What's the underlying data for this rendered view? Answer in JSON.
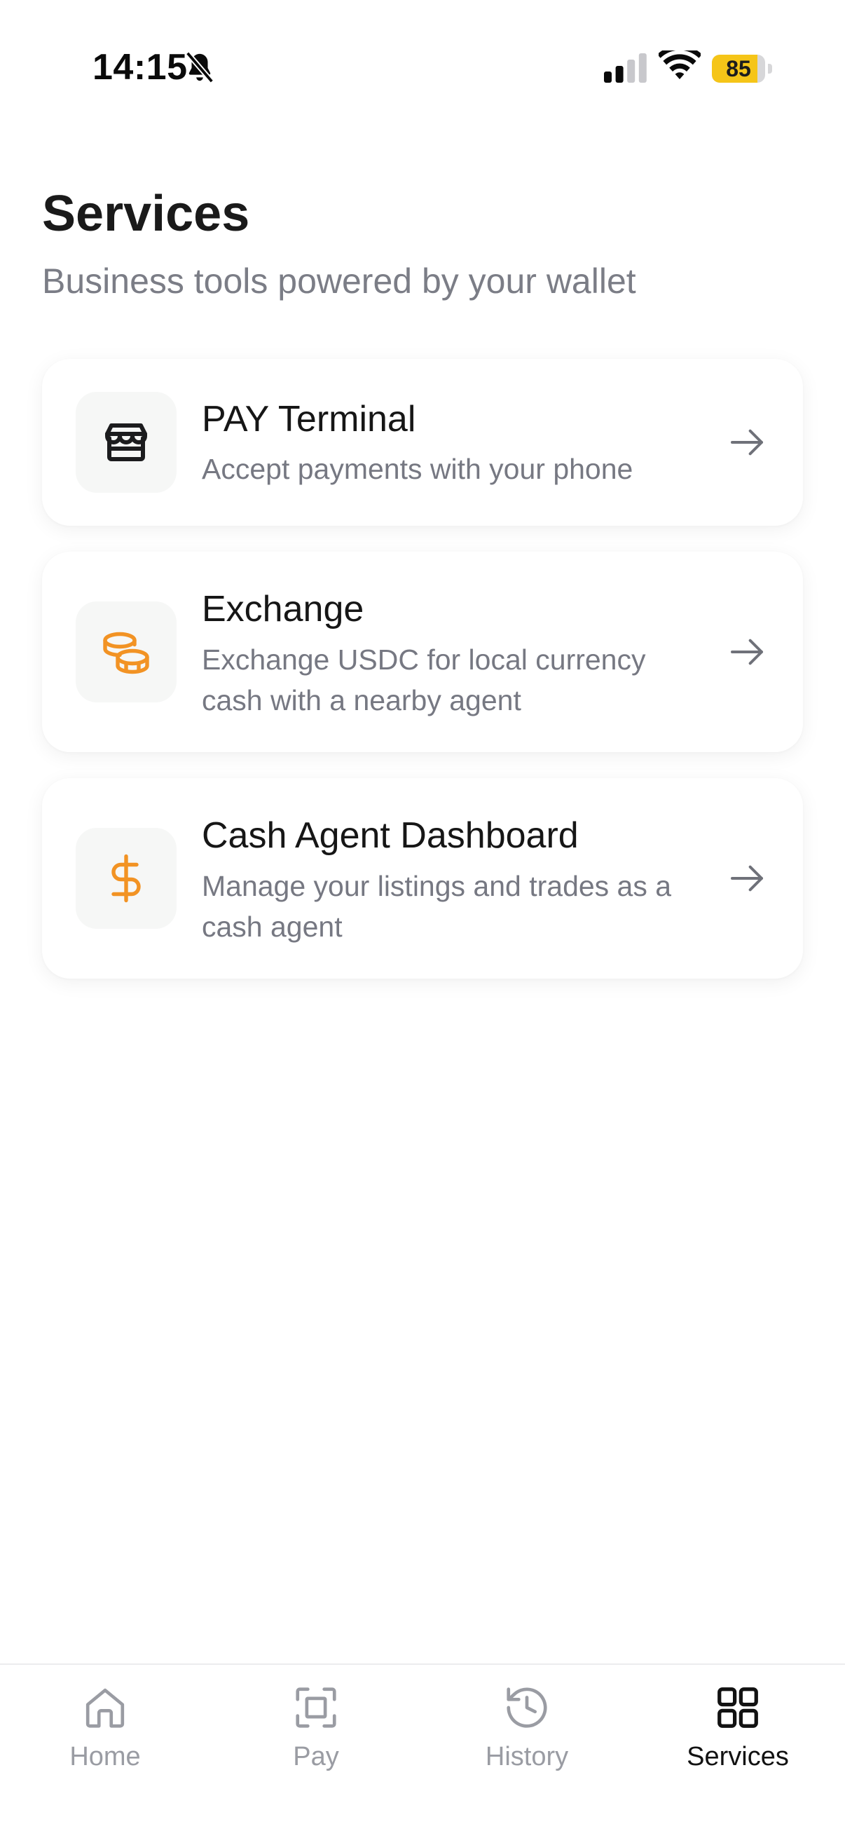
{
  "status_bar": {
    "time": "14:15",
    "battery_level": "85",
    "battery_fraction": 0.85,
    "battery_color": "#f5c518"
  },
  "header": {
    "title": "Services",
    "subtitle": "Business tools powered by your wallet"
  },
  "services": [
    {
      "title": "PAY Terminal",
      "description": "Accept payments with your phone",
      "icon": "storefront-icon",
      "icon_color": "#1c1c1e"
    },
    {
      "title": "Exchange",
      "description": "Exchange USDC for local currency cash with a nearby agent",
      "icon": "coins-icon",
      "icon_color": "#f29324"
    },
    {
      "title": "Cash Agent Dashboard",
      "description": "Manage your listings and trades as a cash agent",
      "icon": "dollar-sign-icon",
      "icon_color": "#f29324"
    }
  ],
  "bottom_nav": {
    "items": [
      {
        "label": "Home",
        "icon": "home-icon",
        "active": false
      },
      {
        "label": "Pay",
        "icon": "scan-icon",
        "active": false
      },
      {
        "label": "History",
        "icon": "history-icon",
        "active": false
      },
      {
        "label": "Services",
        "icon": "grid-icon",
        "active": true
      }
    ]
  },
  "colors": {
    "accent": "#f29324",
    "muted_text": "#7b7d86",
    "inactive_nav": "#9a9ca3"
  }
}
